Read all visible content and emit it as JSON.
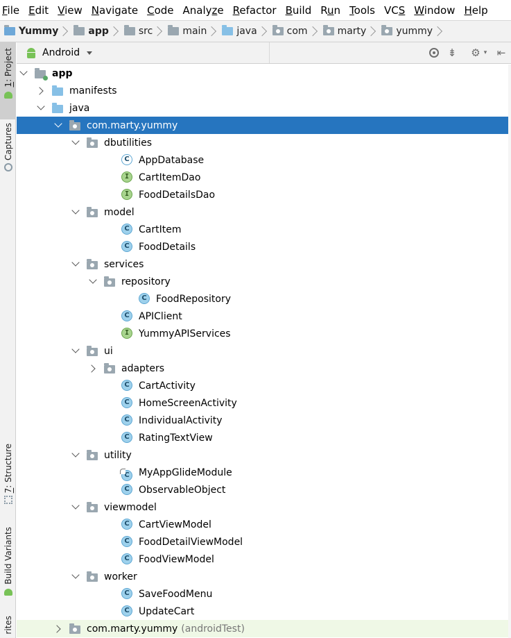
{
  "menu": [
    {
      "label": "File",
      "mn": "F",
      "rest": "ile"
    },
    {
      "label": "Edit",
      "mn": "E",
      "rest": "dit"
    },
    {
      "label": "View",
      "mn": "V",
      "rest": "iew"
    },
    {
      "label": "Navigate",
      "mn": "N",
      "rest": "avigate"
    },
    {
      "label": "Code",
      "mn": "C",
      "rest": "ode"
    },
    {
      "label": "Analyze",
      "pre": "Analy",
      "mn": "z",
      "rest": "e"
    },
    {
      "label": "Refactor",
      "mn": "R",
      "rest": "efactor"
    },
    {
      "label": "Build",
      "mn": "B",
      "rest": "uild"
    },
    {
      "label": "Run",
      "pre": "R",
      "mn": "u",
      "rest": "n"
    },
    {
      "label": "Tools",
      "mn": "T",
      "rest": "ools"
    },
    {
      "label": "VCS",
      "pre": "VC",
      "mn": "S",
      "rest": ""
    },
    {
      "label": "Window",
      "mn": "W",
      "rest": "indow"
    },
    {
      "label": "Help",
      "mn": "H",
      "rest": "elp"
    }
  ],
  "breadcrumb": [
    "Yummy",
    "app",
    "src",
    "main",
    "java",
    "com",
    "marty",
    "yummy"
  ],
  "strip": {
    "project_tab": {
      "num": "1",
      "label": ": Project"
    },
    "captures_tab": "Captures",
    "structure_tab": {
      "num": "7",
      "label": ": Structure"
    },
    "build_variants_tab": "Build Variants",
    "favorites_tab": "rites"
  },
  "project_view": {
    "selected_view": "Android"
  },
  "tree": [
    {
      "label": "app",
      "icon": "module-folder-icon",
      "expand": "down",
      "depth": 0,
      "bold": true
    },
    {
      "label": "manifests",
      "icon": "folder-icon",
      "expand": "right",
      "depth": 1
    },
    {
      "label": "java",
      "icon": "source-folder-icon",
      "expand": "down",
      "depth": 1
    },
    {
      "label": "com.marty.yummy",
      "icon": "package-icon",
      "expand": "down",
      "depth": 2,
      "selected": true
    },
    {
      "label": "dbutilities",
      "icon": "package-icon",
      "expand": "down",
      "depth": 3
    },
    {
      "label": "AppDatabase",
      "icon": "abstract-class-icon",
      "depth": 5
    },
    {
      "label": "CartItemDao",
      "icon": "interface-icon",
      "depth": 5
    },
    {
      "label": "FoodDetailsDao",
      "icon": "interface-icon",
      "depth": 5
    },
    {
      "label": "model",
      "icon": "package-icon",
      "expand": "down",
      "depth": 3
    },
    {
      "label": "CartItem",
      "icon": "class-icon",
      "depth": 5
    },
    {
      "label": "FoodDetails",
      "icon": "class-icon",
      "depth": 5
    },
    {
      "label": "services",
      "icon": "package-icon",
      "expand": "down",
      "depth": 3
    },
    {
      "label": "repository",
      "icon": "package-icon",
      "expand": "down",
      "depth": 4
    },
    {
      "label": "FoodRepository",
      "icon": "class-icon",
      "depth": 6
    },
    {
      "label": "APIClient",
      "icon": "class-icon",
      "depth": 5
    },
    {
      "label": "YummyAPIServices",
      "icon": "interface-icon",
      "depth": 5
    },
    {
      "label": "ui",
      "icon": "package-icon",
      "expand": "down",
      "depth": 3
    },
    {
      "label": "adapters",
      "icon": "package-icon",
      "expand": "right",
      "depth": 4
    },
    {
      "label": "CartActivity",
      "icon": "class-icon",
      "depth": 5
    },
    {
      "label": "HomeScreenActivity",
      "icon": "class-icon",
      "depth": 5
    },
    {
      "label": "IndividualActivity",
      "icon": "class-icon",
      "depth": 5
    },
    {
      "label": "RatingTextView",
      "icon": "class-icon",
      "depth": 5
    },
    {
      "label": "utility",
      "icon": "package-icon",
      "expand": "down",
      "depth": 3
    },
    {
      "label": "MyAppGlideModule",
      "icon": "annotated-class-icon",
      "depth": 5
    },
    {
      "label": "ObservableObject",
      "icon": "class-icon",
      "depth": 5
    },
    {
      "label": "viewmodel",
      "icon": "package-icon",
      "expand": "down",
      "depth": 3
    },
    {
      "label": "CartViewModel",
      "icon": "class-icon",
      "depth": 5
    },
    {
      "label": "FoodDetailViewModel",
      "icon": "class-icon",
      "depth": 5
    },
    {
      "label": "FoodViewModel",
      "icon": "class-icon",
      "depth": 5
    },
    {
      "label": "worker",
      "icon": "package-icon",
      "expand": "down",
      "depth": 3
    },
    {
      "label": "SaveFoodMenu",
      "icon": "class-icon",
      "depth": 5
    },
    {
      "label": "UpdateCart",
      "icon": "class-icon",
      "depth": 5
    },
    {
      "label": "com.marty.yummy",
      "sub": "(androidTest)",
      "icon": "package-icon",
      "expand": "right",
      "depth": 2,
      "test": true
    }
  ],
  "colors": {
    "selection": "#2675bf",
    "test_row": "#eff8e6",
    "class_icon": "#9ed1ec",
    "interface_icon": "#a8d48e"
  }
}
